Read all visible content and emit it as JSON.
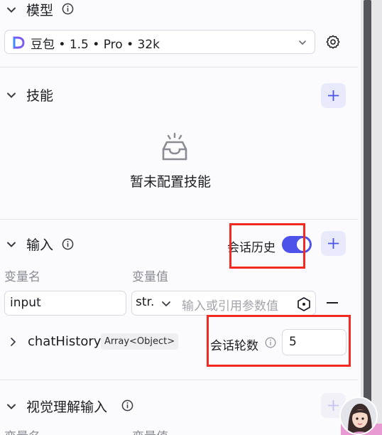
{
  "model_section": {
    "title": "模型",
    "selected_model": "豆包 • 1.5 • Pro • 32k"
  },
  "skills_section": {
    "title": "技能",
    "empty_text": "暂未配置技能"
  },
  "input_section": {
    "title": "输入",
    "history_label": "会话历史",
    "history_enabled": true,
    "col_name": "变量名",
    "col_value": "变量值",
    "rows": [
      {
        "name": "input",
        "type": "str.",
        "placeholder": "输入或引用参数值"
      }
    ],
    "chat_history": {
      "name": "chatHistory",
      "type_tag": "Array<Object>",
      "rounds_label": "会话轮数",
      "rounds_value": "5"
    }
  },
  "vision_section": {
    "title": "视觉理解输入",
    "col_name": "变量名",
    "col_value": "变量值"
  },
  "colors": {
    "accent": "#4d53e8",
    "highlight_box": "#f22a22"
  },
  "icons": [
    "chevron-down-icon",
    "info-icon",
    "gear-icon",
    "plus-icon",
    "inbox-empty-icon",
    "variable-ref-icon",
    "minus-icon",
    "chevron-right-icon"
  ]
}
